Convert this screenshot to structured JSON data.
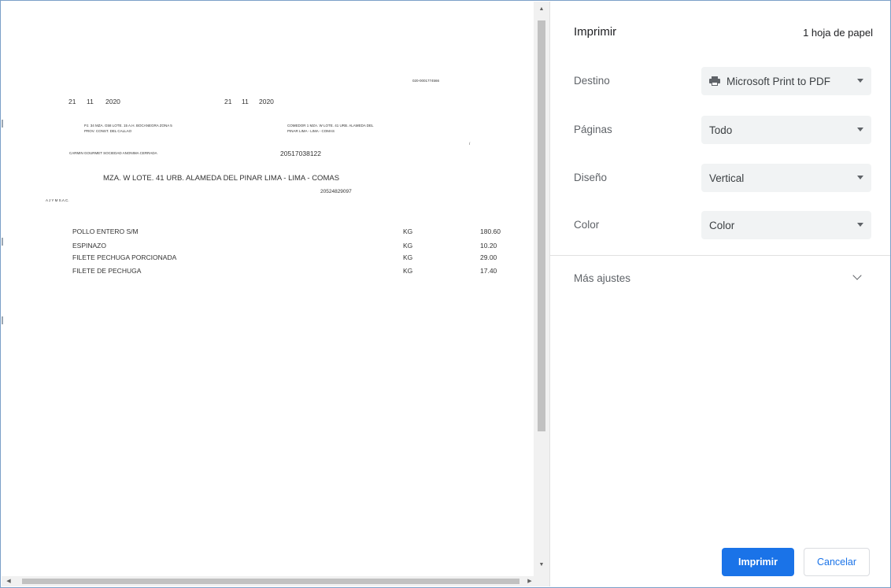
{
  "document": {
    "ruc_code": "020-0001774566",
    "date_left": {
      "day": "21",
      "month": "11",
      "year": "2020"
    },
    "date_right": {
      "day": "21",
      "month": "11",
      "year": "2020"
    },
    "origin_address_1": "PJ. 34 MZA. G58 LOTE. 15 A.H. BOCANEGRA ZONA 5",
    "origin_address_2": "PROV. CONST. DEL CALLAO",
    "destination_address_1": "COMEDOR 1 MZA. W LOTE. 41 URB. ALAMEDA DEL",
    "destination_address_2": "PINAR LIMA - LIMA - COMAS",
    "sender_name": "CARMIN GOURMET SOCIEDAD ANONIMA CERRADA",
    "sender_ruc": "20517038122",
    "side_mark": "/",
    "address_line": "MZA. W LOTE. 41 URB. ALAMEDA DEL PINAR LIMA - LIMA - COMAS",
    "carrier_name": "A J Y M S.A.C.",
    "carrier_ruc": "20524829097",
    "items": [
      {
        "description": "POLLO ENTERO S/M",
        "unit": "KG",
        "quantity": "180.60"
      },
      {
        "description": "ESPINAZO",
        "unit": "KG",
        "quantity": "10.20"
      },
      {
        "description": "FILETE PECHUGA PORCIONADA",
        "unit": "KG",
        "quantity": "29.00"
      },
      {
        "description": "FILETE DE PECHUGA",
        "unit": "KG",
        "quantity": "17.40"
      }
    ]
  },
  "scrollbars": {
    "up_glyph": "▲",
    "down_glyph": "▼",
    "left_glyph": "◀",
    "right_glyph": "▶"
  },
  "panel": {
    "title": "Imprimir",
    "sheet_count": "1 hoja de papel",
    "rows": [
      {
        "label": "Destino",
        "value": "Microsoft Print to PDF",
        "icon": "printer-icon"
      },
      {
        "label": "Páginas",
        "value": "Todo"
      },
      {
        "label": "Diseño",
        "value": "Vertical"
      },
      {
        "label": "Color",
        "value": "Color"
      }
    ],
    "more_settings": "Más ajustes",
    "print_button": "Imprimir",
    "cancel_button": "Cancelar"
  },
  "colors": {
    "accent": "#1a73e8",
    "select_bg": "#f1f3f4",
    "label_text": "#5f6368",
    "frame_border": "#7ba0c8"
  }
}
